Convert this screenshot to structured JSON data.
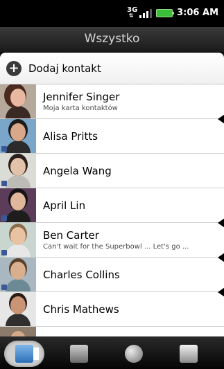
{
  "status_bar": {
    "network_top": "3G",
    "time": "3:06 AM",
    "signal_icon": "signal-strength-icon",
    "battery_icon": "battery-icon"
  },
  "title": "Wszystko",
  "add_contact": {
    "label": "Dodaj kontakt",
    "icon": "plus-icon"
  },
  "contacts": [
    {
      "name": "Jennifer Singer",
      "subtitle": "Moja karta kontaktów"
    },
    {
      "name": "Alisa Pritts",
      "subtitle": ""
    },
    {
      "name": "Angela Wang",
      "subtitle": ""
    },
    {
      "name": "April  Lin",
      "subtitle": ""
    },
    {
      "name": "Ben  Carter",
      "subtitle": "Can't wait for the Superbowl ... Let's go ..."
    },
    {
      "name": "Charles  Collins",
      "subtitle": ""
    },
    {
      "name": "Chris Mathews",
      "subtitle": ""
    }
  ],
  "tabs": [
    {
      "icon": "contacts-card-icon",
      "active": true
    },
    {
      "icon": "groups-icon",
      "active": false
    },
    {
      "icon": "globe-online-directories-icon",
      "active": false
    },
    {
      "icon": "call-history-icon",
      "active": false
    }
  ],
  "colors": {
    "status_bg": "#000000",
    "title_text": "#d7d7d7",
    "list_bg": "#ffffff",
    "tab_active_bg": "#d0d0d0",
    "facebook_badge": "#3b5998",
    "battery": "#3bbf3b"
  }
}
